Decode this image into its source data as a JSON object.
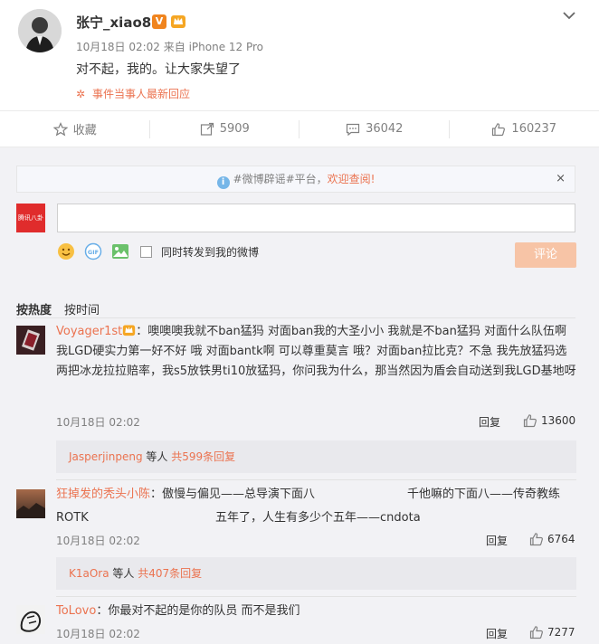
{
  "post": {
    "username": "张宁_xiao8",
    "verified_badge": "V",
    "meta": "10月18日 02:02 来自 iPhone 12 Pro",
    "content": "对不起，我的。让大家失望了",
    "event_link": "事件当事人最新回应"
  },
  "actions": {
    "favorite": "收藏",
    "repost": "5909",
    "comment": "36042",
    "like": "160237"
  },
  "notice": {
    "text": "#微博辟谣#平台，",
    "welcome": "欢迎查阅!",
    "close": "×"
  },
  "composer": {
    "avatar_text": "腾讯八卦",
    "repost_label": "同时转发到我的微博",
    "submit": "评论"
  },
  "sort": {
    "hot": "按热度",
    "time": "按时间"
  },
  "comments": [
    {
      "name": "Voyager1st",
      "text": "：噢噢噢我就不ban猛犸 对面ban我的大圣小小 我就是不ban猛犸 对面什么队伍啊 我LGD硬实力第一好不好 哦 对面bantk啊 可以尊重莫言 哦？对面ban拉比克？不急 我先放猛犸选两把冰龙拉拉赔率，我s5放铁男ti10放猛犸，你问我为什么，那当然因为盾会自动送到我LGD基地呀",
      "time": "10月18日 02:02",
      "reply": "回复",
      "likes": "13600",
      "sub_user": "Jasperjinpeng",
      "sub_mid": " 等人 ",
      "sub_count": "共599条回复"
    },
    {
      "name": "狂掉发的秃头小陈",
      "text_line1": "：傲慢与偏见——总导演下面八",
      "text_line1b": "千他嘛的下面八——传奇教练",
      "text_line2a": "ROTK",
      "text_line2b": "五年了，人生有多少个五年——cndota",
      "time": "10月18日 02:02",
      "reply": "回复",
      "likes": "6764",
      "sub_user": "K1aOra",
      "sub_mid": " 等人 ",
      "sub_count": "共407条回复"
    },
    {
      "name": "ToLovo",
      "text": "：你最对不起的是你的队员 而不是我们",
      "time": "10月18日 02:02",
      "reply": "回复",
      "likes": "7277"
    }
  ],
  "colors": {
    "accent": "#eb7350",
    "muted": "#808080",
    "panel": "#f2f2f5"
  }
}
